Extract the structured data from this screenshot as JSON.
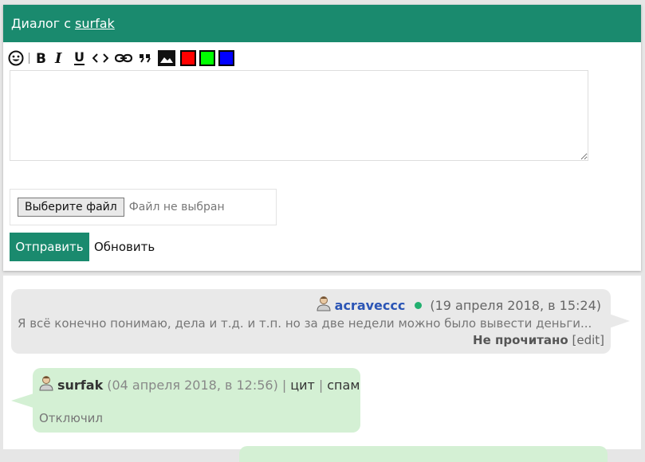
{
  "dialog": {
    "title_prefix": "Диалог с",
    "title_user": "surfak"
  },
  "toolbar": {
    "items": [
      "smiley-icon",
      "bold-icon",
      "italic-icon",
      "underline-icon",
      "code-icon",
      "link-icon",
      "quote-icon",
      "image-icon"
    ],
    "colors": [
      "#ff0000",
      "#00ff00",
      "#0000ff"
    ]
  },
  "compose": {
    "message_value": "",
    "file_button": "Выберите файл",
    "file_status": "Файл не выбран",
    "send_label": "Отправить",
    "refresh_label": "Обновить"
  },
  "messages": [
    {
      "user": "acraveccc",
      "date": "(19 апреля 2018, в 15:24)",
      "text": "Я всё конечно понимаю, дела и т.д. и т.п. но за две недели можно было вывести деньги...",
      "status": "Не прочитано",
      "edit": "[edit]"
    },
    {
      "user": "surfak",
      "date": "(04 апреля 2018, в 12:56)",
      "sep1": "|",
      "quote": "цит",
      "sep2": "|",
      "spam": "спам",
      "text": "Отключил"
    }
  ]
}
